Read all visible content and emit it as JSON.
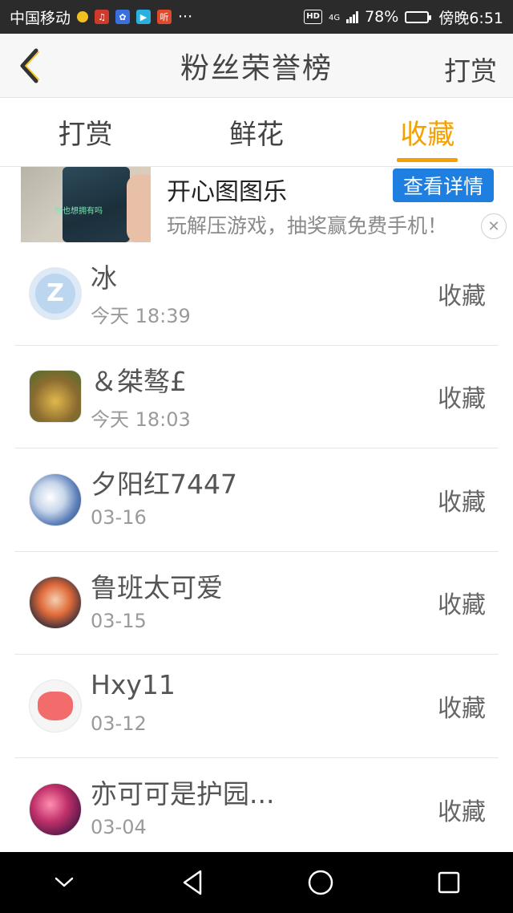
{
  "status_bar": {
    "carrier": "中国移动",
    "more_dots": "···",
    "hd_badge": "HD",
    "network": "4G",
    "battery_percent": "78%",
    "time": "傍晚6:51",
    "battery_level": 0.78
  },
  "header": {
    "title": "粉丝荣誉榜",
    "right_action": "打赏"
  },
  "tabs": [
    {
      "label": "打赏",
      "active": false
    },
    {
      "label": "鲜花",
      "active": false
    },
    {
      "label": "收藏",
      "active": true
    }
  ],
  "ad": {
    "title": "开心图图乐",
    "button": "查看详情",
    "description": "玩解压游戏，抽奖赢免费手机！",
    "thumb_caption": "你也想拥有吗"
  },
  "list": [
    {
      "name": "冰",
      "time": "今天 18:39",
      "action": "收藏",
      "avatar": "avatar-qq-default"
    },
    {
      "name": "＆桀骜£",
      "time": "今天 18:03",
      "action": "收藏",
      "avatar": "avatar-bear"
    },
    {
      "name": "夕阳红7447",
      "time": "03-16",
      "action": "收藏",
      "avatar": "avatar-anime"
    },
    {
      "name": "鲁班太可爱",
      "time": "03-15",
      "action": "收藏",
      "avatar": "avatar-luban"
    },
    {
      "name": "Hxy11",
      "time": "03-12",
      "action": "收藏",
      "avatar": "avatar-pig"
    },
    {
      "name": "亦可可是护园...",
      "time": "03-04",
      "action": "收藏",
      "avatar": "avatar-sunset"
    }
  ],
  "colors": {
    "accent": "#f5a000",
    "ad_button": "#1e7fe0",
    "status_bar": "#2b2b2b",
    "nav_bar": "#000000"
  }
}
